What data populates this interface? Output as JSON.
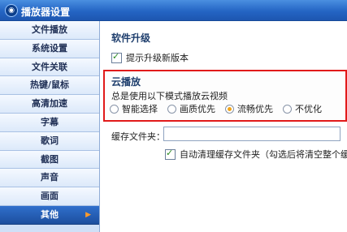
{
  "window": {
    "title": "播放器设置",
    "icon": "player-app-icon"
  },
  "sidebar": {
    "items": [
      {
        "label": "文件播放",
        "active": false
      },
      {
        "label": "系统设置",
        "active": false
      },
      {
        "label": "文件关联",
        "active": false
      },
      {
        "label": "热键/鼠标",
        "active": false
      },
      {
        "label": "高清加速",
        "active": false
      },
      {
        "label": "字幕",
        "active": false
      },
      {
        "label": "歌词",
        "active": false
      },
      {
        "label": "截图",
        "active": false
      },
      {
        "label": "声音",
        "active": false
      },
      {
        "label": "画面",
        "active": false
      },
      {
        "label": "其他",
        "active": true
      }
    ]
  },
  "upgrade": {
    "title": "软件升级",
    "checkbox_label": "提示升级新版本",
    "checked": true
  },
  "cloud": {
    "title": "云播放",
    "prompt": "总是使用以下模式播放云视频",
    "options": [
      "智能选择",
      "画质优先",
      "流畅优先",
      "不优化"
    ],
    "selected": "流畅优先",
    "highlight_color": "#e11a1a"
  },
  "cache": {
    "label": "缓存文件夹：",
    "value": "",
    "auto_clean_label": "自动清理缓存文件夹（勾选后将清空整个缓",
    "auto_clean_checked": true
  },
  "colors": {
    "title_bar": "#2465c4",
    "sidebar_active": "#1d4f9e",
    "accent": "#f2a418"
  }
}
